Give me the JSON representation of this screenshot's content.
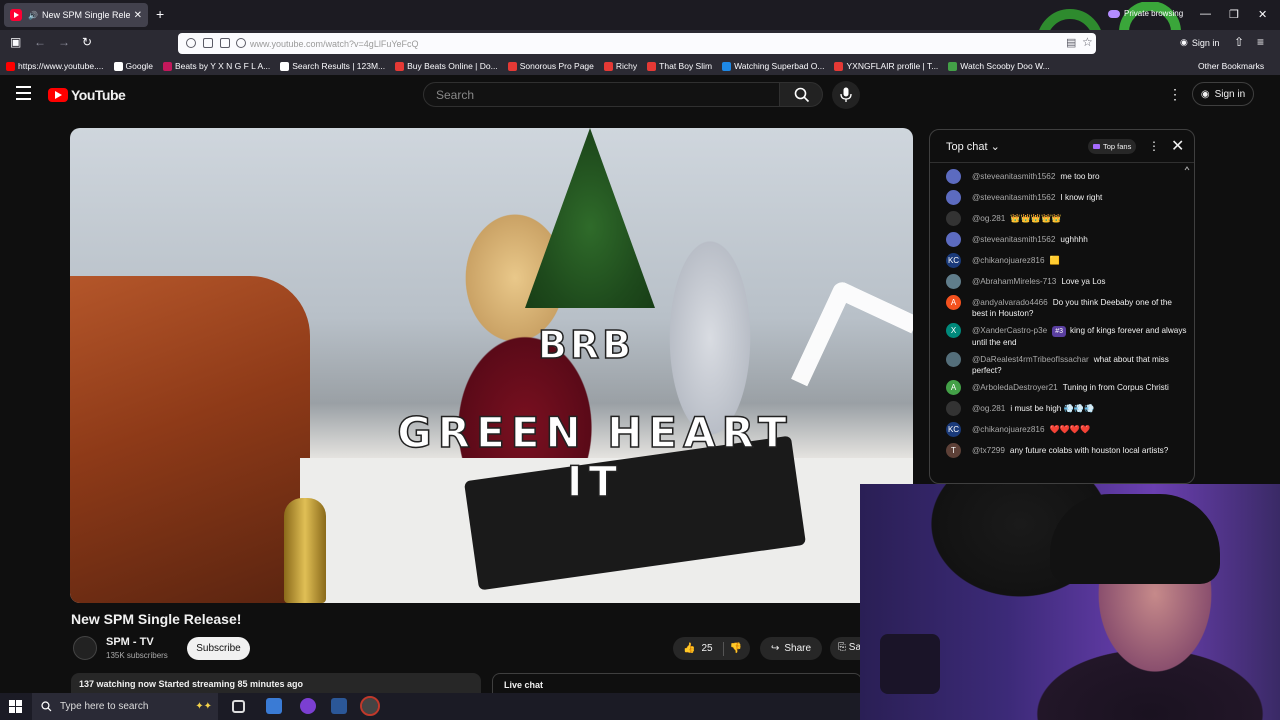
{
  "browser": {
    "tab_title": "New SPM Single Release!",
    "new_tab": "+",
    "private_label": "Private browsing",
    "url": "www.youtube.com/watch?v=4gLlFuYeFcQ",
    "signin_label": "Sign in",
    "bookmarks": [
      {
        "label": "https://www.youtube....",
        "color": "#ff0000"
      },
      {
        "label": "Google",
        "color": "#ffffff"
      },
      {
        "label": "Beats by Y X N G F L A...",
        "color": "#c2185b"
      },
      {
        "label": "Search Results | 123M...",
        "color": "#ffffff"
      },
      {
        "label": "Buy Beats Online | Do...",
        "color": "#e53935"
      },
      {
        "label": "Sonorous Pro Page",
        "color": "#e53935"
      },
      {
        "label": "Richy",
        "color": "#e53935"
      },
      {
        "label": "That Boy Slim",
        "color": "#e53935"
      },
      {
        "label": "Watching Superbad O...",
        "color": "#1e88e5"
      },
      {
        "label": "YXNGFLAIR profile | T...",
        "color": "#e53935"
      },
      {
        "label": "Watch Scooby Doo W...",
        "color": "#43a047"
      }
    ],
    "other_bookmarks": "Other Bookmarks"
  },
  "youtube": {
    "logo_text": "YouTube",
    "search_placeholder": "Search",
    "signin_label": "Sign in",
    "overlay_brb": "BRB",
    "overlay_green": "GREEN HEART IT",
    "video_title": "New SPM Single Release!",
    "channel_name": "SPM - TV",
    "channel_subs": "135K subscribers",
    "subscribe_label": "Subscribe",
    "likes": "25",
    "share_label": "Share",
    "save_label": "Sa",
    "stats": "137 watching now  Started streaming 85 minutes ago",
    "live_chat_label": "Live chat"
  },
  "chat": {
    "title": "Top chat",
    "top_fans": "Top fans",
    "messages": [
      {
        "author": "@steveanitasmith1562",
        "text": "me too bro",
        "avatar": "#5c6bc0",
        "initial": ""
      },
      {
        "author": "@steveanitasmith1562",
        "text": "I know right",
        "avatar": "#5c6bc0",
        "initial": ""
      },
      {
        "author": "@og.281",
        "text": "👑👑👑👑👑",
        "avatar": "#333333",
        "initial": ""
      },
      {
        "author": "@steveanitasmith1562",
        "text": "ughhhh",
        "avatar": "#5c6bc0",
        "initial": ""
      },
      {
        "author": "@chikanojuarez816",
        "text": "🟨",
        "avatar": "#1a3a7a",
        "initial": "KC"
      },
      {
        "author": "@AbrahamMireles-713",
        "text": "Love ya Los",
        "avatar": "#607d8b",
        "initial": ""
      },
      {
        "author": "@andyalvarado4466",
        "text": "Do you think Deebaby one of the best in Houston?",
        "avatar": "#f4511e",
        "initial": "A"
      },
      {
        "author": "@XanderCastro-p3e",
        "badge": "#3",
        "text": "king of kings forever and always until the end",
        "avatar": "#00897b",
        "initial": "X"
      },
      {
        "author": "@DaRealest4rmTribeofIssachar",
        "text": "what about that miss perfect?",
        "avatar": "#546e7a",
        "initial": ""
      },
      {
        "author": "@ArboledaDestroyer21",
        "text": "Tuning in from Corpus Christi",
        "avatar": "#43a047",
        "initial": "A"
      },
      {
        "author": "@og.281",
        "text": "i must be high 💨💨💨",
        "avatar": "#333333",
        "initial": ""
      },
      {
        "author": "@chikanojuarez816",
        "text": "❤️❤️❤️❤️",
        "avatar": "#1a3a7a",
        "initial": "KC"
      },
      {
        "author": "@tx7299",
        "text": "any future colabs with houston local artists?",
        "avatar": "#5d4037",
        "initial": "T"
      }
    ]
  },
  "taskbar": {
    "search_placeholder": "Type here to search"
  }
}
